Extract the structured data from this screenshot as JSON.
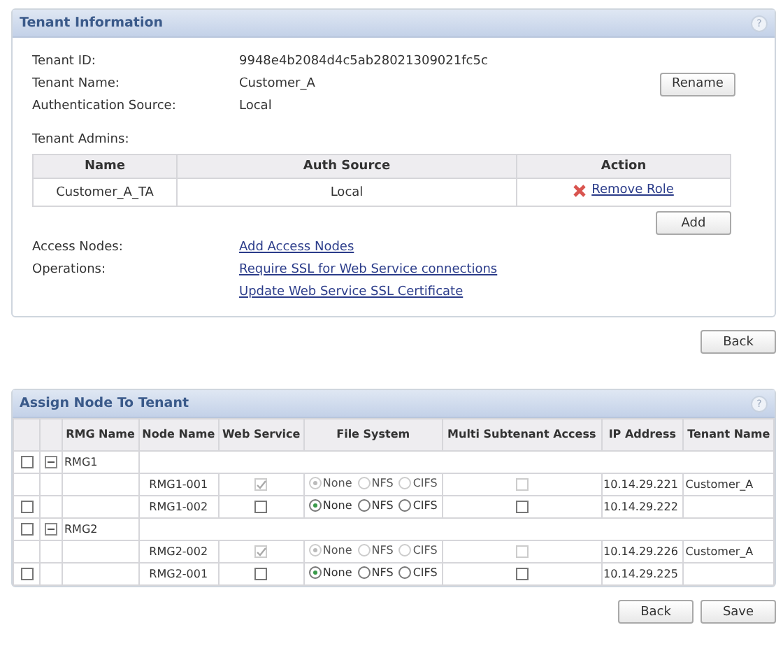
{
  "tenant_panel": {
    "title": "Tenant Information",
    "help": "?",
    "fields": [
      {
        "label": "Tenant ID:",
        "value": "9948e4b2084d4c5ab28021309021fc5c"
      },
      {
        "label": "Tenant Name:",
        "value": "Customer_A"
      },
      {
        "label": "Authentication Source:",
        "value": "Local"
      }
    ],
    "rename_button": "Rename",
    "admins_label": "Tenant Admins:",
    "admins_table": {
      "columns": [
        "Name",
        "Auth Source",
        "Action"
      ],
      "rows": [
        {
          "name": "Customer_A_TA",
          "auth_source": "Local",
          "action": "Remove Role"
        }
      ]
    },
    "add_button": "Add",
    "links": [
      {
        "label": "Access Nodes:",
        "link": "Add Access Nodes"
      },
      {
        "label": "Operations:",
        "link": "Require SSL for Web Service connections"
      },
      {
        "link": "Update Web Service SSL Certificate"
      }
    ]
  },
  "back_button": "Back",
  "assign_panel": {
    "title": "Assign Node To Tenant",
    "help": "?",
    "columns": [
      "RMG Name",
      "Node Name",
      "Web Service",
      "File System",
      "Multi Subtenant Access",
      "IP Address",
      "Tenant Name"
    ],
    "groups": [
      {
        "name": "RMG1",
        "checked": false,
        "expanded": true,
        "nodes": [
          {
            "name": "RMG1-001",
            "disabled": true,
            "web_service": true,
            "file_system": [
              {
                "label": "None",
                "selected": true
              },
              {
                "label": "NFS",
                "selected": false
              },
              {
                "label": "CIFS",
                "selected": false
              }
            ],
            "multi_subtenant": false,
            "ip": "10.14.29.221",
            "tenant": "Customer_A"
          },
          {
            "name": "RMG1-002",
            "disabled": false,
            "checked": false,
            "web_service": false,
            "file_system": [
              {
                "label": "None",
                "selected": true
              },
              {
                "label": "NFS",
                "selected": false
              },
              {
                "label": "CIFS",
                "selected": false
              }
            ],
            "multi_subtenant": false,
            "ip": "10.14.29.222"
          }
        ]
      },
      {
        "name": "RMG2",
        "checked": false,
        "expanded": true,
        "nodes": [
          {
            "name": "RMG2-002",
            "disabled": true,
            "web_service": true,
            "file_system": [
              {
                "label": "None",
                "selected": true
              },
              {
                "label": "NFS",
                "selected": false
              },
              {
                "label": "CIFS",
                "selected": false
              }
            ],
            "multi_subtenant": false,
            "ip": "10.14.29.226",
            "tenant": "Customer_A"
          },
          {
            "name": "RMG2-001",
            "disabled": false,
            "checked": false,
            "web_service": false,
            "file_system": [
              {
                "label": "None",
                "selected": true
              },
              {
                "label": "NFS",
                "selected": false
              },
              {
                "label": "CIFS",
                "selected": false
              }
            ],
            "multi_subtenant": false,
            "ip": "10.14.29.225"
          }
        ]
      }
    ],
    "buttons": [
      "Back",
      "Save"
    ]
  }
}
